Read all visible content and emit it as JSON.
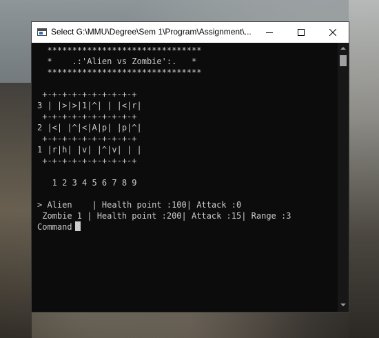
{
  "window": {
    "title": "Select G:\\MMU\\Degree\\Sem 1\\Program\\Assignment\\...",
    "title_bar_color": "#ffffff",
    "console_background": "#0c0c0c",
    "console_text_color": "#cccccc",
    "icons": [
      "console-app-icon",
      "minimize-icon",
      "maximize-icon",
      "close-icon"
    ]
  },
  "console": {
    "banner": [
      "  *******************************",
      "  *    .:'Alien vs Zombie':.   *",
      "  *******************************"
    ],
    "board": [
      " +-+-+-+-+-+-+-+-+-+",
      "3 | |>|>|1|^| | |<|r|",
      " +-+-+-+-+-+-+-+-+-+",
      "2 |<| |^|<|A|p| |p|^|",
      " +-+-+-+-+-+-+-+-+-+",
      "1 |r|h| |v| |^|v| | |",
      " +-+-+-+-+-+-+-+-+-+"
    ],
    "column_numbers": "   1 2 3 4 5 6 7 8 9",
    "status": [
      "> Alien    | Health point :100| Attack :0",
      " Zombie 1 | Health point :200| Attack :15| Range :3"
    ],
    "prompt": "Command"
  }
}
